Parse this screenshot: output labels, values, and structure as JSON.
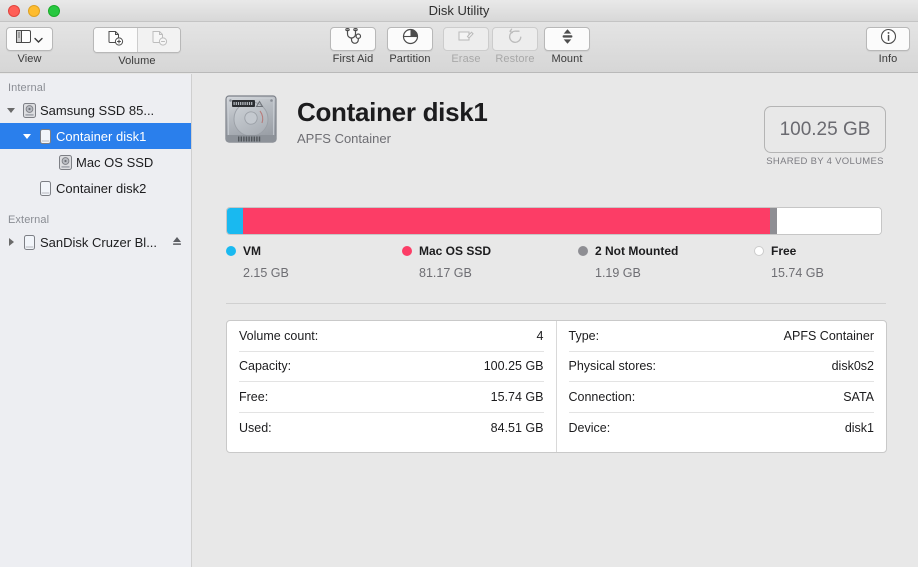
{
  "window": {
    "title": "Disk Utility"
  },
  "toolbar": {
    "view": {
      "label": "View",
      "icon": "sidebar-icon",
      "chevron": "chevron-down-icon"
    },
    "volume": {
      "label": "Volume",
      "add_icon": "add-volume-icon",
      "remove_icon": "remove-volume-icon"
    },
    "first_aid": {
      "label": "First Aid",
      "icon": "stethoscope-icon",
      "enabled": true
    },
    "partition": {
      "label": "Partition",
      "icon": "pie-chart-icon",
      "enabled": true
    },
    "erase": {
      "label": "Erase",
      "icon": "erase-icon",
      "enabled": false
    },
    "restore": {
      "label": "Restore",
      "icon": "restore-arrow-icon",
      "enabled": false
    },
    "mount": {
      "label": "Mount",
      "icon": "mount-icon",
      "enabled": true
    },
    "info": {
      "label": "Info",
      "icon": "info-circle-icon"
    }
  },
  "sidebar": {
    "sections": [
      {
        "header": "Internal",
        "items": [
          {
            "label": "Samsung SSD 85...",
            "icon": "hard-disk-icon",
            "indent": 0,
            "twisty": "down",
            "selected": false
          },
          {
            "label": "Container disk1",
            "icon": "volume-icon",
            "indent": 1,
            "twisty": "down",
            "selected": true
          },
          {
            "label": "Mac OS SSD",
            "icon": "hard-disk-icon",
            "indent": 2,
            "twisty": "none",
            "selected": false
          },
          {
            "label": "Container disk2",
            "icon": "volume-icon",
            "indent": 1,
            "twisty": "none",
            "selected": false
          }
        ]
      },
      {
        "header": "External",
        "items": [
          {
            "label": "SanDisk Cruzer Bl...",
            "icon": "volume-icon",
            "indent": 0,
            "twisty": "right",
            "selected": false,
            "eject": true
          }
        ]
      }
    ]
  },
  "main": {
    "disk_name": "Container disk1",
    "disk_type": "APFS Container",
    "disk_icon": "hard-drive-large-icon",
    "capacity_badge": "100.25 GB",
    "capacity_note": "SHARED BY 4 VOLUMES"
  },
  "chart_data": {
    "type": "bar",
    "title": "Container disk1 capacity usage",
    "total": "100.25 GB",
    "total_value": 100.25,
    "unit": "GB",
    "categories": [
      "VM",
      "Mac OS SSD",
      "2 Not Mounted",
      "Free"
    ],
    "values": [
      2.15,
      81.17,
      1.19,
      15.74
    ],
    "labels": [
      "2.15 GB",
      "81.17 GB",
      "1.19 GB",
      "15.74 GB"
    ],
    "colors": [
      "#19b9f0",
      "#fc3d66",
      "#8e8e93",
      "#ffffff"
    ],
    "segments": [
      {
        "name": "VM",
        "size": "2.15 GB",
        "value": 2.15,
        "color": "#19b9f0",
        "percent": 2.4
      },
      {
        "name": "Mac OS SSD",
        "size": "81.17 GB",
        "value": 81.17,
        "color": "#fc3d66",
        "percent": 80.7
      },
      {
        "name": "2 Not Mounted",
        "size": "1.19 GB",
        "value": 1.19,
        "color": "#8e8e93",
        "percent": 1.0
      },
      {
        "name": "Free",
        "size": "15.74 GB",
        "value": 15.74,
        "color": "#ffffff",
        "percent": 15.9
      }
    ],
    "legend": "inline-below",
    "grid": false
  },
  "info_table": {
    "left": [
      {
        "label": "Volume count:",
        "value": "4"
      },
      {
        "label": "Capacity:",
        "value": "100.25 GB"
      },
      {
        "label": "Free:",
        "value": "15.74 GB"
      },
      {
        "label": "Used:",
        "value": "84.51 GB"
      }
    ],
    "right": [
      {
        "label": "Type:",
        "value": "APFS Container"
      },
      {
        "label": "Physical stores:",
        "value": "disk0s2"
      },
      {
        "label": "Connection:",
        "value": "SATA"
      },
      {
        "label": "Device:",
        "value": "disk1"
      }
    ]
  }
}
